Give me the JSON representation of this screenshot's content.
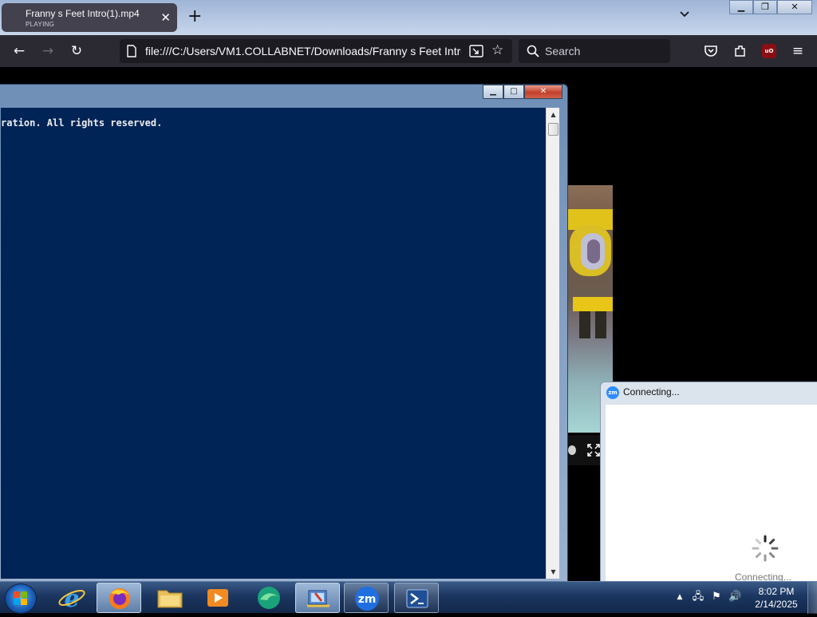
{
  "browser": {
    "tab": {
      "title": "Franny s Feet Intro(1).mp4",
      "status": "PLAYING"
    },
    "url": "file:///C:/Users/VM1.COLLABNET/Downloads/Franny s Feet Intro(",
    "search_placeholder": "Search"
  },
  "console": {
    "line1": "ration. All rights reserved."
  },
  "zoom_dialog": {
    "title": "Connecting...",
    "status": "Connecting..."
  },
  "taskbar": {
    "apps": [
      "internet-explorer",
      "firefox",
      "file-explorer",
      "media-player",
      "edge-app",
      "control-panel",
      "zoom",
      "powershell"
    ],
    "clock_time": "8:02 PM",
    "clock_date": "2/14/2025"
  }
}
